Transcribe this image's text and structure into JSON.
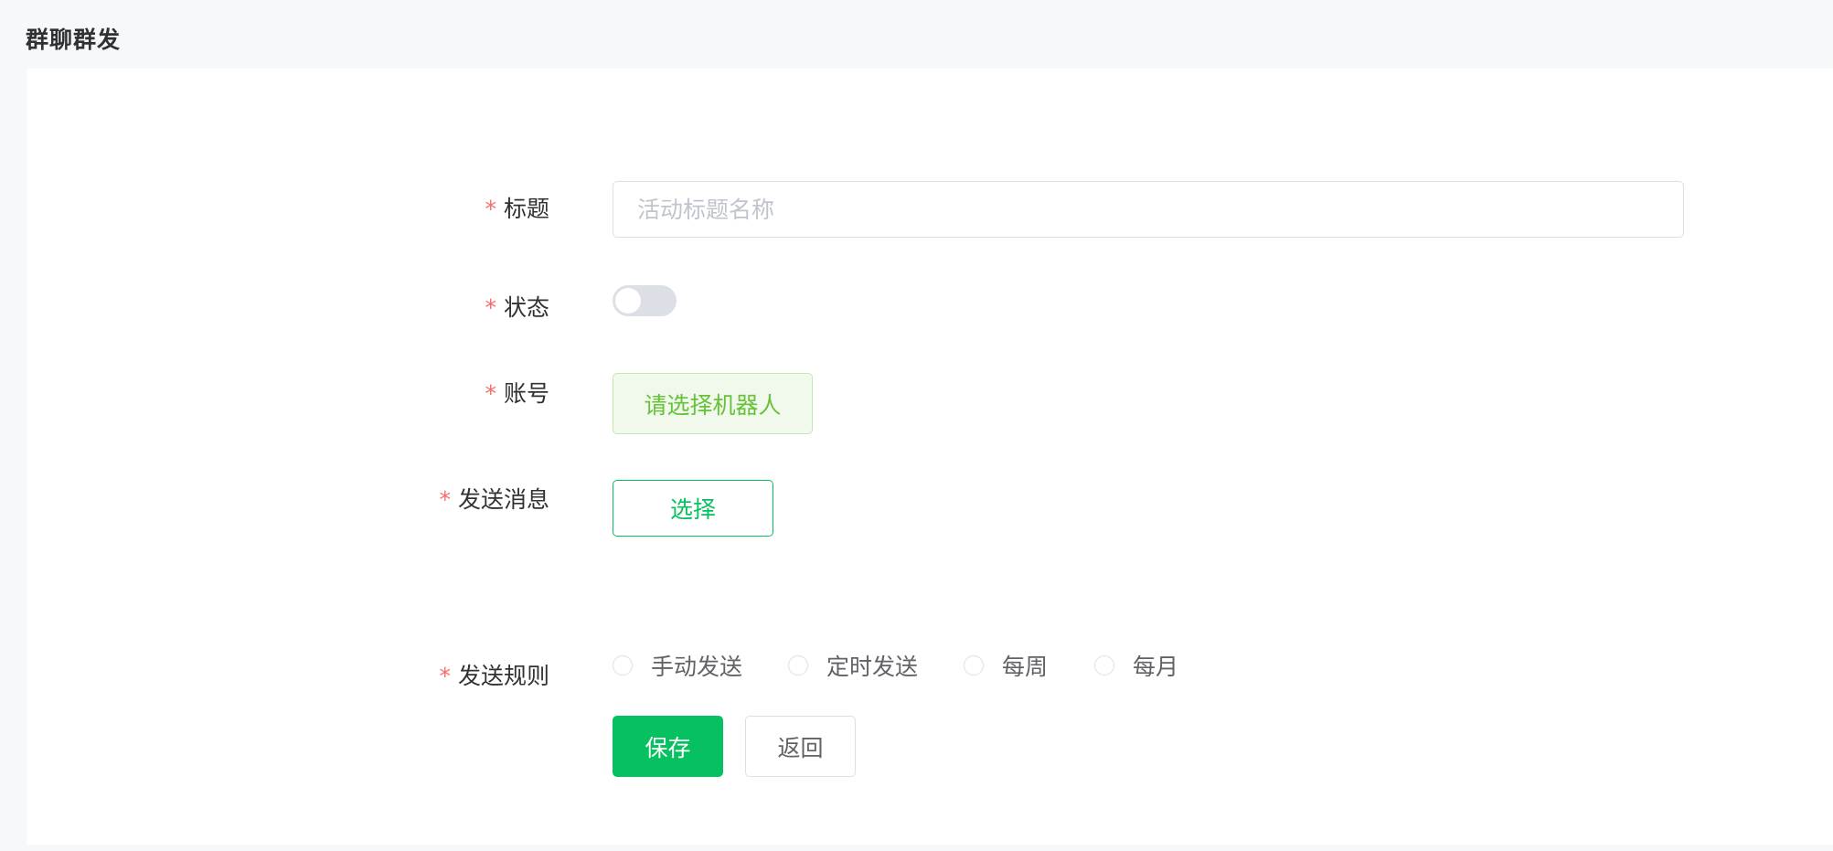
{
  "page": {
    "title": "群聊群发"
  },
  "form": {
    "required_mark": "*",
    "title": {
      "label": "标题",
      "placeholder": "活动标题名称",
      "value": ""
    },
    "status": {
      "label": "状态",
      "enabled": false
    },
    "account": {
      "label": "账号",
      "button_label": "请选择机器人"
    },
    "message": {
      "label": "发送消息",
      "button_label": "选择"
    },
    "rule": {
      "label": "发送规则",
      "options": [
        "手动发送",
        "定时发送",
        "每周",
        "每月"
      ],
      "selected": null
    }
  },
  "actions": {
    "save_label": "保存",
    "back_label": "返回"
  },
  "colors": {
    "brand": "#07c160",
    "required": "#f56c6c",
    "robot_button_text": "#67c23a",
    "switch_off": "#dcdfe6"
  }
}
